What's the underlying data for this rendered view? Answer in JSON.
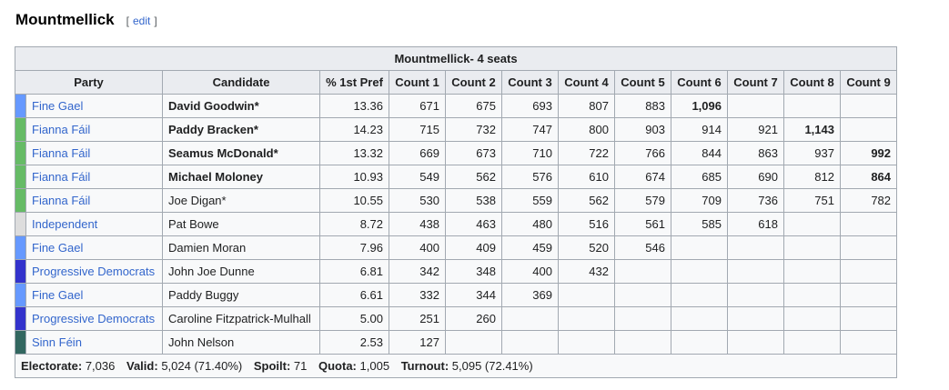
{
  "section": {
    "title": "Mountmellick",
    "edit_open": "[",
    "edit_label": "edit",
    "edit_close": "]"
  },
  "table": {
    "caption": "Mountmellick- 4 seats",
    "headers": {
      "party": "Party",
      "candidate": "Candidate",
      "first_pref": "% 1st Pref",
      "counts": [
        "Count 1",
        "Count 2",
        "Count 3",
        "Count 4",
        "Count 5",
        "Count 6",
        "Count 7",
        "Count 8",
        "Count 9"
      ]
    },
    "party_colors": {
      "Fine Gael": "#6699ff",
      "Fianna Fáil": "#66bb66",
      "Independent": "#dddddd",
      "Progressive Democrats": "#3333cc",
      "Sinn Féin": "#326760"
    },
    "rows": [
      {
        "party": "Fine Gael",
        "candidate": "David Goodwin*",
        "candidate_bold": true,
        "first_pref": "13.36",
        "counts": [
          "671",
          "675",
          "693",
          "807",
          "883",
          "1,096",
          "",
          "",
          ""
        ],
        "bold_count": 5
      },
      {
        "party": "Fianna Fáil",
        "candidate": "Paddy Bracken*",
        "candidate_bold": true,
        "first_pref": "14.23",
        "counts": [
          "715",
          "732",
          "747",
          "800",
          "903",
          "914",
          "921",
          "1,143",
          ""
        ],
        "bold_count": 7
      },
      {
        "party": "Fianna Fáil",
        "candidate": "Seamus McDonald*",
        "candidate_bold": true,
        "first_pref": "13.32",
        "counts": [
          "669",
          "673",
          "710",
          "722",
          "766",
          "844",
          "863",
          "937",
          "992"
        ],
        "bold_count": 8
      },
      {
        "party": "Fianna Fáil",
        "candidate": "Michael Moloney",
        "candidate_bold": true,
        "first_pref": "10.93",
        "counts": [
          "549",
          "562",
          "576",
          "610",
          "674",
          "685",
          "690",
          "812",
          "864"
        ],
        "bold_count": 8
      },
      {
        "party": "Fianna Fáil",
        "candidate": "Joe Digan*",
        "candidate_bold": false,
        "first_pref": "10.55",
        "counts": [
          "530",
          "538",
          "559",
          "562",
          "579",
          "709",
          "736",
          "751",
          "782"
        ],
        "bold_count": -1
      },
      {
        "party": "Independent",
        "candidate": "Pat Bowe",
        "candidate_bold": false,
        "first_pref": "8.72",
        "counts": [
          "438",
          "463",
          "480",
          "516",
          "561",
          "585",
          "618",
          "",
          ""
        ],
        "bold_count": -1
      },
      {
        "party": "Fine Gael",
        "candidate": "Damien Moran",
        "candidate_bold": false,
        "first_pref": "7.96",
        "counts": [
          "400",
          "409",
          "459",
          "520",
          "546",
          "",
          "",
          "",
          ""
        ],
        "bold_count": -1
      },
      {
        "party": "Progressive Democrats",
        "candidate": "John Joe Dunne",
        "candidate_bold": false,
        "first_pref": "6.81",
        "counts": [
          "342",
          "348",
          "400",
          "432",
          "",
          "",
          "",
          "",
          ""
        ],
        "bold_count": -1
      },
      {
        "party": "Fine Gael",
        "candidate": "Paddy Buggy",
        "candidate_bold": false,
        "first_pref": "6.61",
        "counts": [
          "332",
          "344",
          "369",
          "",
          "",
          "",
          "",
          "",
          ""
        ],
        "bold_count": -1
      },
      {
        "party": "Progressive Democrats",
        "candidate": "Caroline Fitzpatrick-Mulhall",
        "candidate_bold": false,
        "first_pref": "5.00",
        "counts": [
          "251",
          "260",
          "",
          "",
          "",
          "",
          "",
          "",
          ""
        ],
        "bold_count": -1
      },
      {
        "party": "Sinn Féin",
        "candidate": "John Nelson",
        "candidate_bold": false,
        "first_pref": "2.53",
        "counts": [
          "127",
          "",
          "",
          "",
          "",
          "",
          "",
          "",
          ""
        ],
        "bold_count": -1
      }
    ],
    "footer": {
      "electorate_label": "Electorate:",
      "electorate_value": "7,036",
      "valid_label": "Valid:",
      "valid_value": "5,024 (71.40%)",
      "spoilt_label": "Spoilt:",
      "spoilt_value": "71",
      "quota_label": "Quota:",
      "quota_value": "1,005",
      "turnout_label": "Turnout:",
      "turnout_value": "5,095 (72.41%)"
    }
  }
}
